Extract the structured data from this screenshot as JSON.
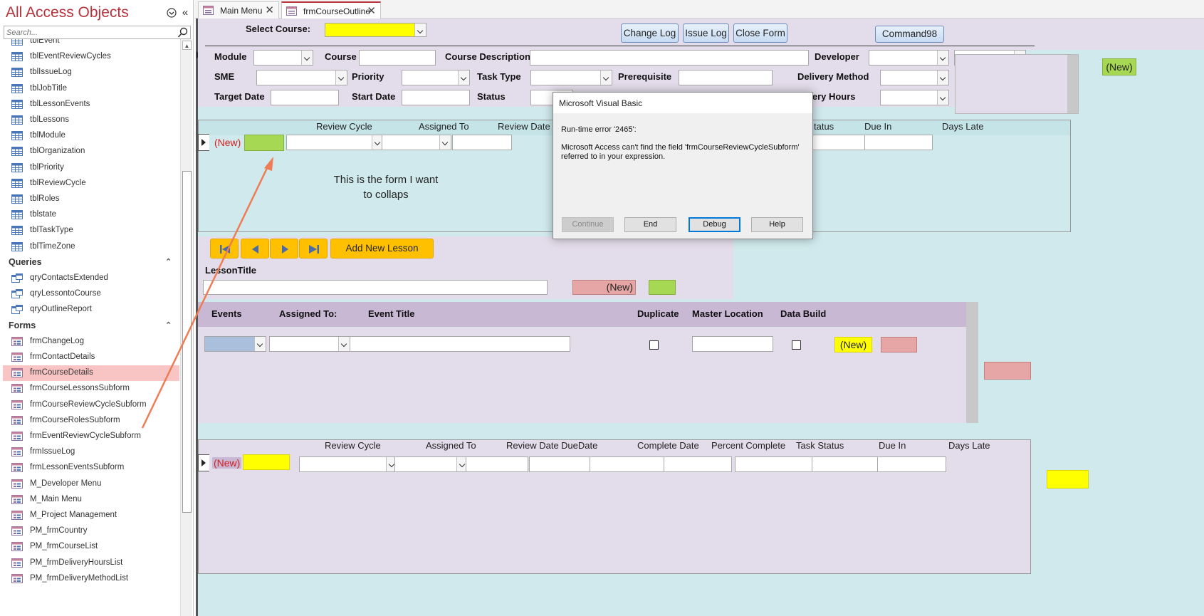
{
  "nav": {
    "title": "All Access Objects",
    "search_placeholder": "Search...",
    "tables": [
      "tblEvent",
      "tblEventReviewCycles",
      "tblIssueLog",
      "tblJobTitle",
      "tblLessonEvents",
      "tblLessons",
      "tblModule",
      "tblOrganization",
      "tblPriority",
      "tblReviewCycle",
      "tblRoles",
      "tblstate",
      "tblTaskType",
      "tblTimeZone"
    ],
    "queries_label": "Queries",
    "queries": [
      "qryContactsExtended",
      "qryLessontoCourse",
      "qryOutlineReport"
    ],
    "forms_label": "Forms",
    "forms": [
      "frmChangeLog",
      "frmContactDetails",
      "frmCourseDetails",
      "frmCourseLessonsSubform",
      "frmCourseReviewCycleSubform",
      "frmCourseRolesSubform",
      "frmEventReviewCycleSubform",
      "frmIssueLog",
      "frmLessonEventsSubform",
      "M_Developer Menu",
      "M_Main Menu",
      "M_Project Management",
      "PM_frmCountry",
      "PM_frmCourseList",
      "PM_frmDeliveryHoursList",
      "PM_frmDeliveryMethodList"
    ],
    "selected_form": "frmCourseDetails"
  },
  "tabs": [
    {
      "label": "Main Menu",
      "active": false
    },
    {
      "label": "frmCourseOutline",
      "active": true
    }
  ],
  "header": {
    "select_course_label": "Select Course:",
    "buttons": {
      "change_log": "Change Log",
      "issue_log": "Issue Log",
      "close_form": "Close Form",
      "command98": "Command98"
    }
  },
  "course": {
    "module_label": "Module",
    "course_label": "Course",
    "course_description_label": "Course Description",
    "developer_label": "Developer",
    "sme_label": "SME",
    "priority_label": "Priority",
    "task_type_label": "Task Type",
    "prerequisite_label": "Prerequisite",
    "delivery_method_label": "Delivery Method",
    "target_date_label": "Target Date",
    "start_date_label": "Start Date",
    "status_label": "Status",
    "delivery_hours_label": "ivery Hours",
    "new_label": "(New)"
  },
  "review_subform": {
    "columns": {
      "review_cycle": "Review Cycle",
      "assigned_to": "Assigned To",
      "review_date": "Review Date",
      "status": "tatus",
      "due_in": "Due In",
      "days_late": "Days Late"
    },
    "new_label": "(New)",
    "annotation_line1": "This is the form I want",
    "annotation_line2": "to collaps"
  },
  "lessons": {
    "add_new_lesson": "Add New Lesson",
    "lesson_title_label": "LessonTitle",
    "new_label": "(New)"
  },
  "events": {
    "columns": {
      "events": "Events",
      "assigned_to": "Assigned To:",
      "event_title": "Event Title",
      "duplicate": "Duplicate",
      "master_location": "Master Location",
      "data_build": "Data Build"
    },
    "new_label": "(New)"
  },
  "event_review": {
    "columns": {
      "review_cycle": "Review Cycle",
      "assigned_to": "Assigned To",
      "review_date": "Review Date",
      "due_date": "DueDate",
      "complete_date": "Complete Date",
      "percent_complete": "Percent Complete",
      "task_status": "Task Status",
      "due_in": "Due In",
      "days_late": "Days Late"
    },
    "new_label": "(New)"
  },
  "dialog": {
    "title": "Microsoft Visual Basic",
    "error": "Run-time error '2465':",
    "message_line1": "Microsoft Access can't find the field 'frmCourseReviewCycleSubform'",
    "message_line2": "referred to in your expression.",
    "buttons": {
      "continue": "Continue",
      "end": "End",
      "debug": "Debug",
      "help": "Help"
    }
  },
  "colors": {
    "access_red": "#b8313b",
    "yellow": "#ffff00",
    "green": "#a6d854",
    "pink": "#e6a6a6",
    "header_purple": "#e3dcea",
    "teal": "#cfe9ec",
    "arrow": "#ee7d55"
  }
}
